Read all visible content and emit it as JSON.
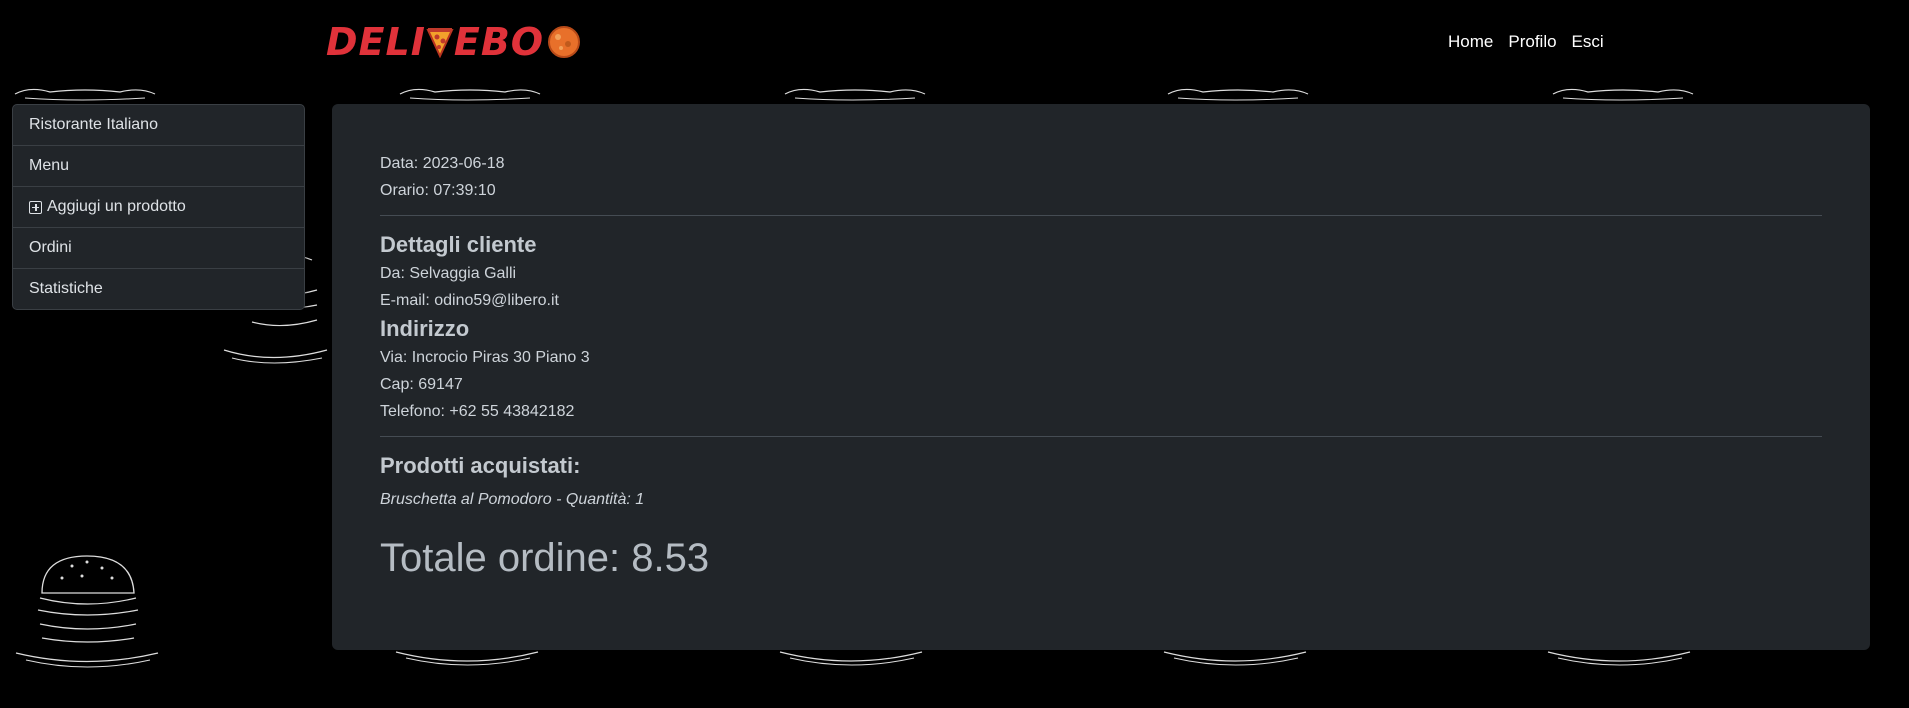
{
  "brand": {
    "name": "DELIVEBOO",
    "prefix": "DELI",
    "suffix": "EBO",
    "color": "#e0323a"
  },
  "topnav": {
    "home": "Home",
    "profile": "Profilo",
    "logout": "Esci"
  },
  "sidebar": {
    "items": [
      {
        "label": "Ristorante Italiano"
      },
      {
        "label": "Menu"
      },
      {
        "label": "Aggiugi un prodotto",
        "icon": "plus-square-icon"
      },
      {
        "label": "Ordini"
      },
      {
        "label": "Statistiche"
      }
    ]
  },
  "order": {
    "date": "Data: 2023-06-18",
    "time": "Orario: 07:39:10",
    "customer_heading": "Dettagli cliente",
    "customer_name": "Da: Selvaggia Galli",
    "customer_email": "E-mail: odino59@libero.it",
    "address_heading": "Indirizzo",
    "street": "Via: Incrocio Piras 30 Piano 3",
    "cap": "Cap: 69147",
    "phone": "Telefono: +62 55 43842182",
    "products_heading": "Prodotti acquistati:",
    "products": [
      "Bruschetta al Pomodoro - Quantità: 1"
    ],
    "total": "Totale ordine: 8.53"
  },
  "colors": {
    "background": "#000000",
    "panel": "#212529",
    "accent": "#e0323a"
  }
}
